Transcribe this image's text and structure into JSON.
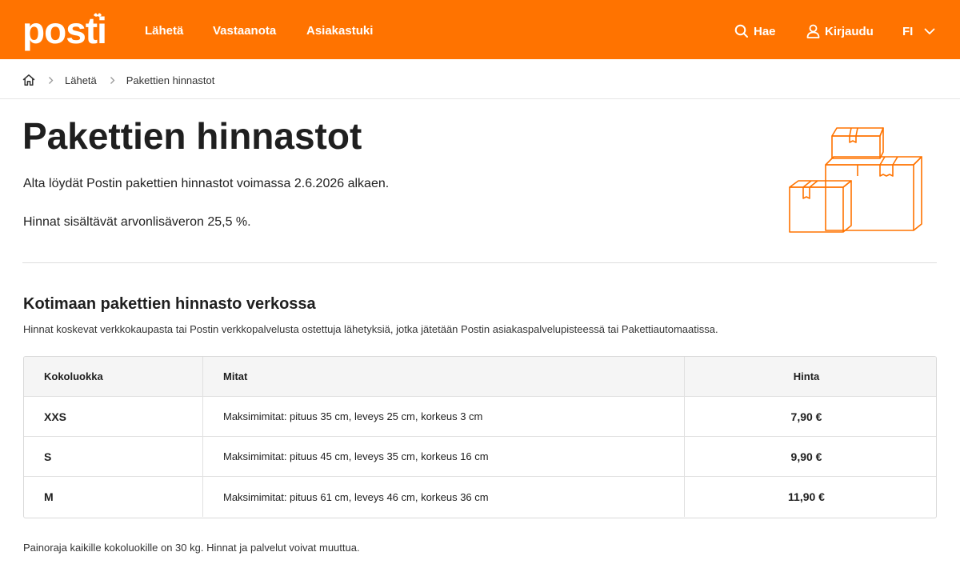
{
  "brand": {
    "logo_text": "posti",
    "accent": "#ff7300"
  },
  "header": {
    "nav": [
      {
        "label": "Lähetä"
      },
      {
        "label": "Vastaanota"
      },
      {
        "label": "Asiakastuki"
      }
    ],
    "search_label": "Hae",
    "login_label": "Kirjaudu",
    "language": "FI",
    "icons": {
      "search": "search-icon",
      "login": "user-icon",
      "language": "chevron-down-icon"
    }
  },
  "breadcrumb": {
    "home_icon": "home-icon",
    "items": [
      {
        "label": "Lähetä"
      },
      {
        "label": "Pakettien hinnastot"
      }
    ]
  },
  "intro": {
    "title": "Pakettien hinnastot",
    "line1": "Alta löydät Postin pakettien hinnastot voimassa 2.6.2026 alkaen.",
    "line2": "Hinnat sisältävät arvonlisäveron 25,5 %."
  },
  "section": {
    "title": "Kotimaan pakettien hinnasto verkossa",
    "description": "Hinnat koskevat verkkokaupasta tai Postin verkkopalvelusta ostettuja lähetyksiä, jotka jätetään Postin asiakaspalvelupisteessä tai Pakettiautomaatissa.",
    "table": {
      "headers": [
        "Kokoluokka",
        "Mitat",
        "Hinta"
      ],
      "rows": [
        {
          "size": "XXS",
          "dimensions": "Maksimimitat: pituus 35 cm, leveys 25 cm, korkeus 3 cm",
          "price": "7,90 €"
        },
        {
          "size": "S",
          "dimensions": "Maksimimitat: pituus 45 cm, leveys 35 cm, korkeus 16 cm",
          "price": "9,90 €"
        },
        {
          "size": "M",
          "dimensions": "Maksimimitat: pituus 61 cm, leveys 46 cm, korkeus 36 cm",
          "price": "11,90 €"
        }
      ]
    }
  },
  "footnote": "Painoraja kaikille kokoluokille on 30 kg. Hinnat ja palvelut voivat muuttua."
}
